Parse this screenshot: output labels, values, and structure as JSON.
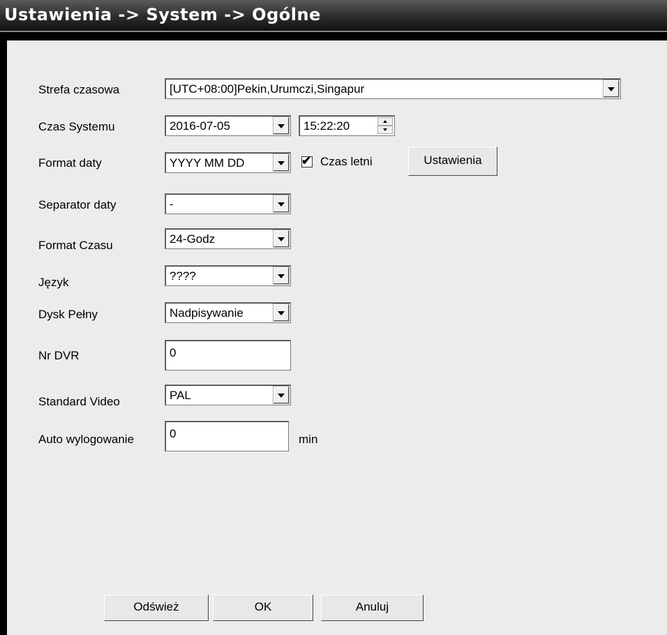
{
  "title": "Ustawienia -> System -> Ogólne",
  "fields": {
    "timezone": {
      "label": "Strefa czasowa",
      "value": "[UTC+08:00]Pekin,Urumczi,Singapur"
    },
    "system_time": {
      "label": "Czas Systemu",
      "date": "2016-07-05",
      "time": "15:22:20"
    },
    "date_format": {
      "label": "Format daty",
      "value": "YYYY MM DD"
    },
    "dst": {
      "label": "Czas letni",
      "checked": true,
      "button": "Ustawienia"
    },
    "date_separator": {
      "label": "Separator daty",
      "value": "-"
    },
    "time_format": {
      "label": "Format Czasu",
      "value": "24-Godz"
    },
    "language": {
      "label": "Język",
      "value": "????"
    },
    "disk_full": {
      "label": "Dysk Pełny",
      "value": "Nadpisywanie"
    },
    "dvr_no": {
      "label": "Nr DVR",
      "value": "0"
    },
    "video_standard": {
      "label": "Standard Video",
      "value": "PAL"
    },
    "auto_logout": {
      "label": "Auto wylogowanie",
      "value": "0",
      "unit": "min"
    }
  },
  "buttons": {
    "refresh": "Odśwież",
    "ok": "OK",
    "cancel": "Anuluj"
  }
}
